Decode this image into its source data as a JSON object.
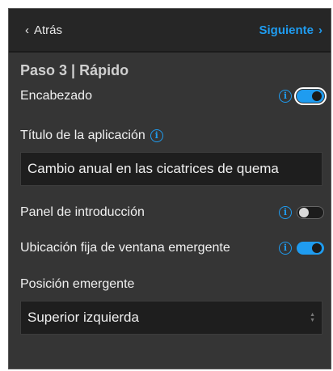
{
  "nav": {
    "back_label": "Atrás",
    "next_label": "Siguiente"
  },
  "step": {
    "title": "Paso 3 | Rápido"
  },
  "header_setting": {
    "label": "Encabezado",
    "enabled": true
  },
  "app_title": {
    "label": "Título de la aplicación",
    "value": "Cambio anual en las cicatrices de quema"
  },
  "intro_panel": {
    "label": "Panel de introducción",
    "enabled": false
  },
  "fixed_popup": {
    "label": "Ubicación fija de ventana emergente",
    "enabled": true
  },
  "popup_position": {
    "label": "Posición emergente",
    "selected": "Superior izquierda"
  },
  "colors": {
    "accent": "#1f9cf0",
    "panel_bg": "#353535",
    "nav_bg": "#262626"
  }
}
